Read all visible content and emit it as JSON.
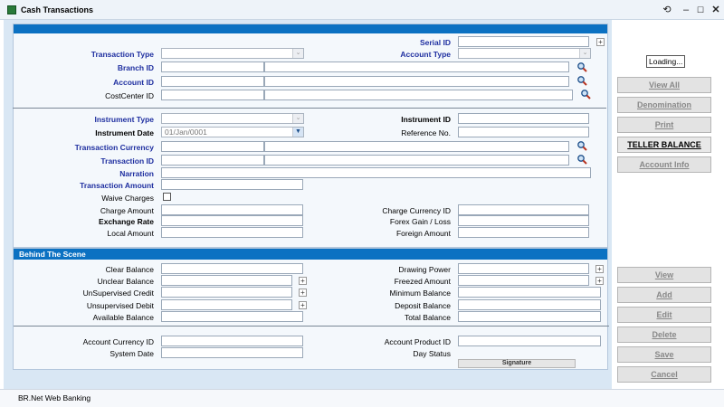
{
  "window": {
    "title": "Cash Transactions"
  },
  "status_bar": {
    "text": "BR.Net Web Banking"
  },
  "loading": {
    "text": "Loading..."
  },
  "form": {
    "serial_id": {
      "label": "Serial ID",
      "value": ""
    },
    "transaction_type": {
      "label": "Transaction Type",
      "value": ""
    },
    "account_type": {
      "label": "Account Type",
      "value": ""
    },
    "branch_id": {
      "label": "Branch ID",
      "value": ""
    },
    "account_id": {
      "label": "Account ID",
      "value": ""
    },
    "costcenter_id": {
      "label": "CostCenter ID",
      "value": ""
    },
    "instrument_type": {
      "label": "Instrument Type",
      "value": ""
    },
    "instrument_id": {
      "label": "Instrument ID",
      "value": ""
    },
    "instrument_date": {
      "label": "Instrument Date",
      "value": "01/Jan/0001"
    },
    "reference_no": {
      "label": "Reference No.",
      "value": ""
    },
    "transaction_currency": {
      "label": "Transaction Currency",
      "value": ""
    },
    "transaction_id": {
      "label": "Transaction ID",
      "value": ""
    },
    "narration": {
      "label": "Narration",
      "value": ""
    },
    "transaction_amount": {
      "label": "Transaction Amount",
      "value": ""
    },
    "waive_charges": {
      "label": "Waive Charges",
      "checked": false
    },
    "charge_amount": {
      "label": "Charge Amount",
      "value": ""
    },
    "charge_currency_id": {
      "label": "Charge Currency ID",
      "value": ""
    },
    "exchange_rate": {
      "label": "Exchange Rate",
      "value": ""
    },
    "forex_gain_loss": {
      "label": "Forex Gain / Loss",
      "value": ""
    },
    "local_amount": {
      "label": "Local Amount",
      "value": ""
    },
    "foreign_amount": {
      "label": "Foreign Amount",
      "value": ""
    }
  },
  "behind_scene": {
    "title": "Behind The Scene",
    "clear_balance": {
      "label": "Clear Balance",
      "value": ""
    },
    "drawing_power": {
      "label": "Drawing Power",
      "value": ""
    },
    "unclear_balance": {
      "label": "Unclear Balance",
      "value": ""
    },
    "freezed_amount": {
      "label": "Freezed Amount",
      "value": ""
    },
    "unsupervised_credit": {
      "label": "UnSupervised Credit",
      "value": ""
    },
    "minimum_balance": {
      "label": "Minimum Balance",
      "value": ""
    },
    "unsupervised_debit": {
      "label": "Unsupervised Debit",
      "value": ""
    },
    "deposit_balance": {
      "label": "Deposit Balance",
      "value": ""
    },
    "available_balance": {
      "label": "Available Balance",
      "value": ""
    },
    "total_balance": {
      "label": "Total Balance",
      "value": ""
    }
  },
  "footer_fields": {
    "account_currency_id": {
      "label": "Account Currency ID",
      "value": ""
    },
    "account_product_id": {
      "label": "Account Product ID",
      "value": ""
    },
    "system_date": {
      "label": "System Date",
      "value": ""
    },
    "day_status": {
      "label": "Day Status",
      "value": ""
    },
    "signature_label": "Signature"
  },
  "side_buttons": {
    "view_all": "View All",
    "denomination": "Denomination",
    "print": "Print",
    "teller_balance": "TELLER BALANCE",
    "account_info": "Account Info",
    "view": "View",
    "add": "Add",
    "edit": "Edit",
    "delete": "Delete",
    "save": "Save",
    "cancel": "Cancel"
  },
  "icons": {
    "app": "app-icon",
    "refresh": "refresh-icon",
    "minimize": "minimize-icon",
    "maximize": "maximize-icon",
    "close": "close-icon",
    "lookup": "magnifier-icon"
  },
  "colors": {
    "header_blue": "#0b71c2",
    "label_blue": "#1f2fa0",
    "panel_bg": "#d9e7f4"
  }
}
